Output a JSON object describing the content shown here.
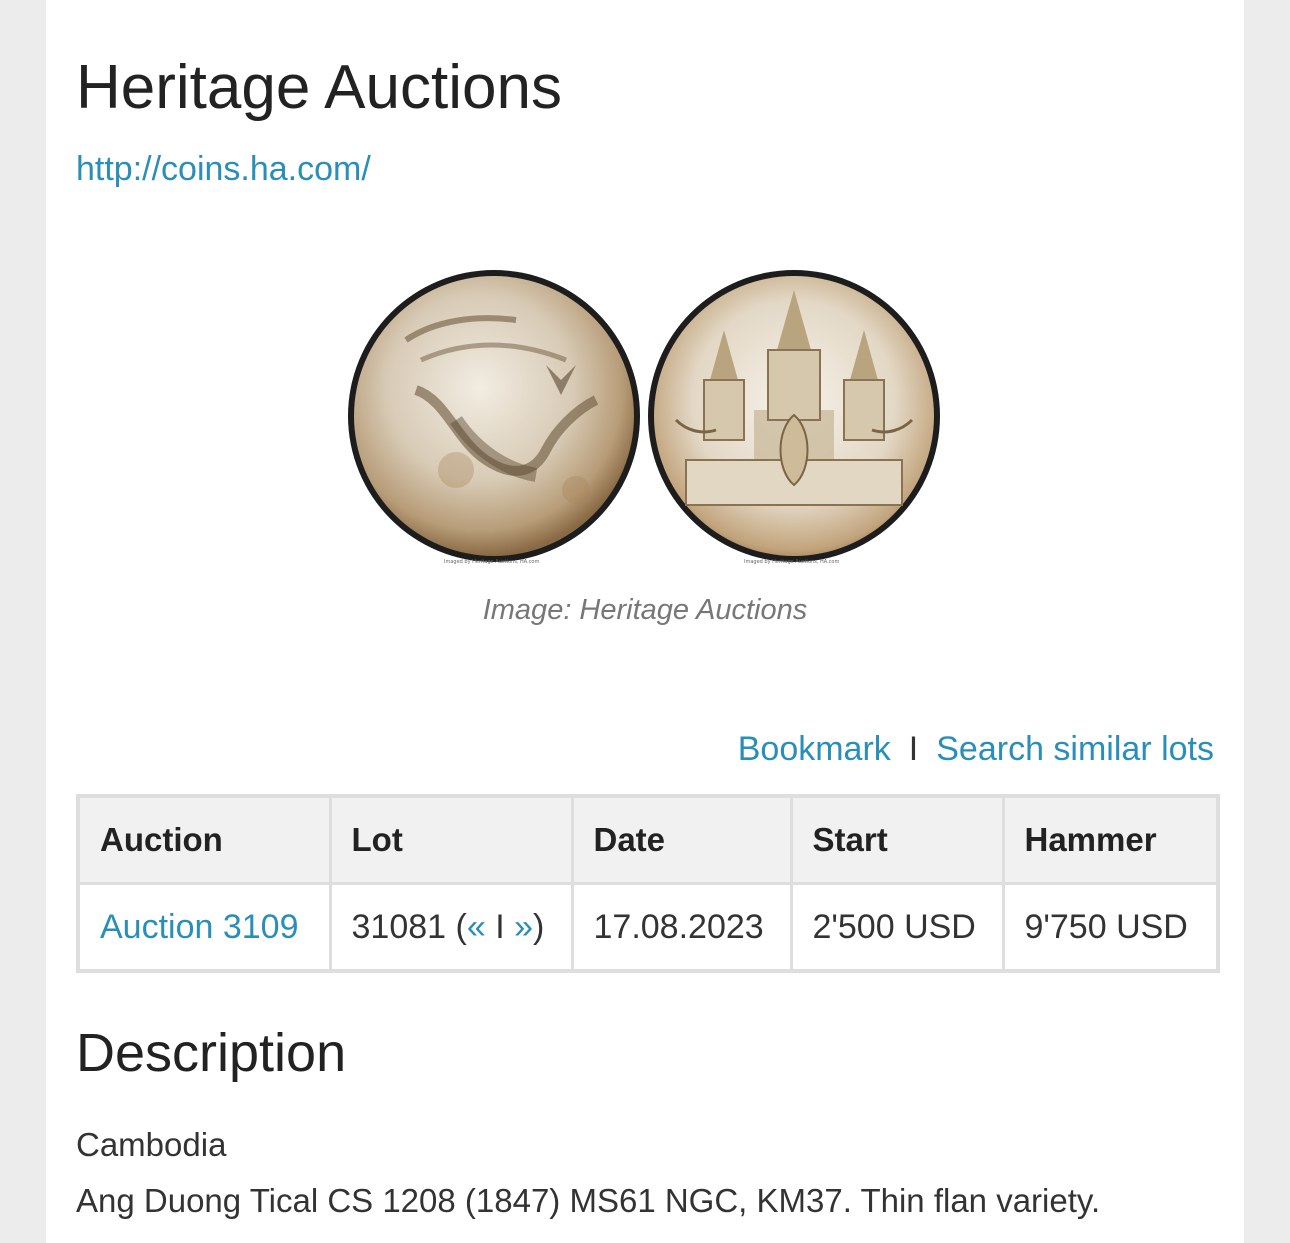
{
  "header": {
    "title": "Heritage Auctions",
    "link": "http://coins.ha.com/"
  },
  "image": {
    "caption": "Image: Heritage Auctions",
    "obverse_icon": "coin-obverse-bird-image",
    "reverse_icon": "coin-reverse-temple-image",
    "watermark": "Imaged by Heritage Auctions, HA.com"
  },
  "actions": {
    "bookmark": "Bookmark",
    "separator": "I",
    "search_similar": "Search similar lots"
  },
  "table": {
    "headers": [
      "Auction",
      "Lot",
      "Date",
      "Start",
      "Hammer"
    ],
    "row": {
      "auction": "Auction 3109",
      "lot_number": "31081",
      "lot_open": "(",
      "prev": "«",
      "lot_sep": "I",
      "next": "»",
      "lot_close": ")",
      "date": "17.08.2023",
      "start": "2'500 USD",
      "hammer": "9'750 USD"
    }
  },
  "description": {
    "heading": "Description",
    "lines": [
      "Cambodia",
      "Ang Duong Tical CS 1208 (1847) MS61 NGC, KM37. Thin flan variety."
    ]
  },
  "colors": {
    "link": "#2a8fb8",
    "background": "#ececec",
    "table_border": "#dedede",
    "table_header_bg": "#f1f1f1"
  }
}
